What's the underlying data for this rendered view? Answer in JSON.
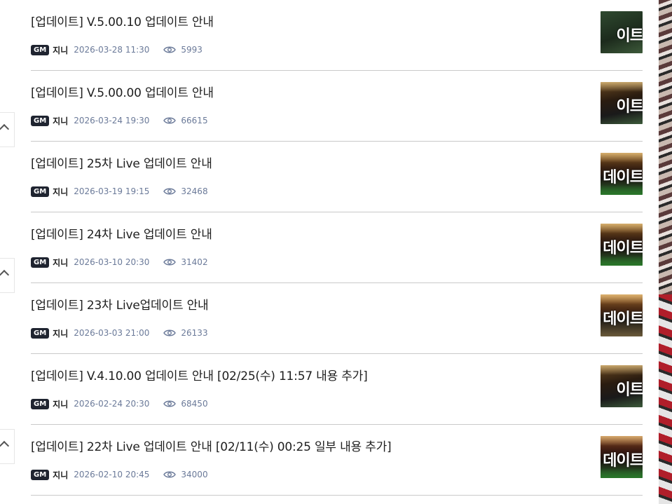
{
  "posts": [
    {
      "title": "[업데이트] V.5.00.10 업데이트 안내",
      "badge": "GM",
      "author": "지니",
      "date": "2026-03-28 11:30",
      "views": "5993",
      "thumb_text": "이트"
    },
    {
      "title": "[업데이트] V.5.00.00 업데이트 안내",
      "badge": "GM",
      "author": "지니",
      "date": "2026-03-24 19:30",
      "views": "66615",
      "thumb_text": "이트"
    },
    {
      "title": "[업데이트] 25차 Live 업데이트 안내",
      "badge": "GM",
      "author": "지니",
      "date": "2026-03-19 19:15",
      "views": "32468",
      "thumb_text": "데이트"
    },
    {
      "title": "[업데이트] 24차 Live 업데이트 안내",
      "badge": "GM",
      "author": "지니",
      "date": "2026-03-10 20:30",
      "views": "31402",
      "thumb_text": "데이트"
    },
    {
      "title": "[업데이트] 23차 Live업데이트 안내",
      "badge": "GM",
      "author": "지니",
      "date": "2026-03-03 21:00",
      "views": "26133",
      "thumb_text": "데이트"
    },
    {
      "title": "[업데이트] V.4.10.00 업데이트 안내 [02/25(수) 11:57 내용 추가]",
      "badge": "GM",
      "author": "지니",
      "date": "2026-02-24 20:30",
      "views": "68450",
      "thumb_text": "이트"
    },
    {
      "title": "[업데이트] 22차 Live 업데이트 안내 [02/11(수) 00:25 일부 내용 추가]",
      "badge": "GM",
      "author": "지니",
      "date": "2026-02-10 20:45",
      "views": "34000",
      "thumb_text": "데이트"
    }
  ],
  "icons": {
    "collapse": "chevron-up-icon",
    "views": "eye-icon"
  },
  "colors": {
    "meta_text": "#6b7a99",
    "badge_bg": "#1f2430",
    "divider": "#c9c9c9"
  }
}
